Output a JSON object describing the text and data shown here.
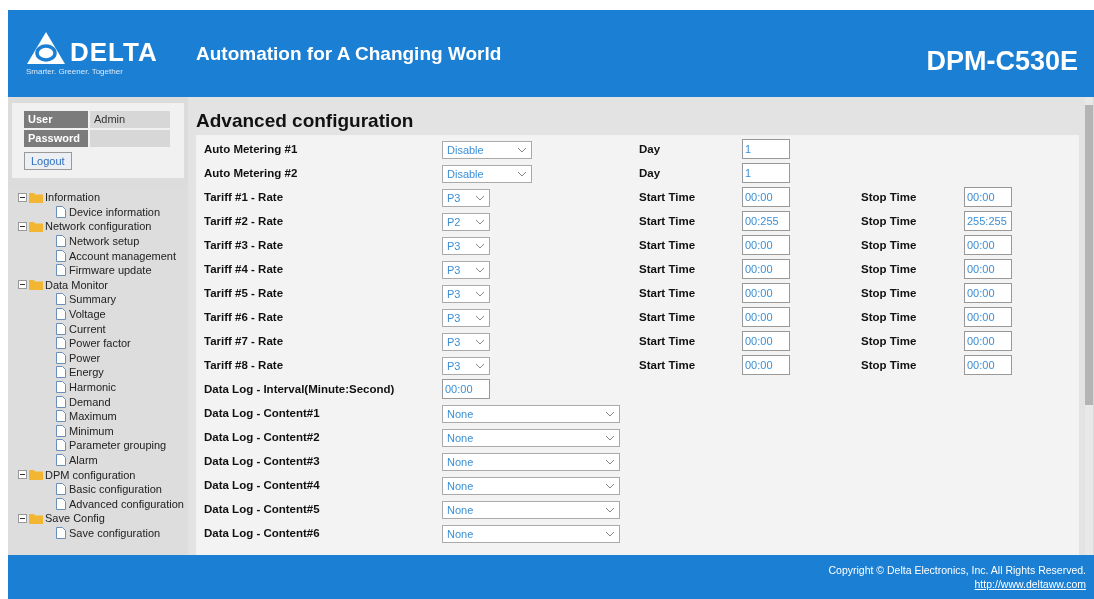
{
  "header": {
    "logo": {
      "name": "DELTA",
      "tagline": "Smarter. Greener. Together"
    },
    "slogan": "Automation for A Changing World",
    "model": "DPM-C530E"
  },
  "login": {
    "user_label": "User",
    "user_value": "Admin",
    "password_label": "Password",
    "logout": "Logout"
  },
  "tree": [
    {
      "label": "Information",
      "expanded": true,
      "children": [
        {
          "label": "Device information"
        }
      ]
    },
    {
      "label": "Network configuration",
      "expanded": true,
      "children": [
        {
          "label": "Network setup"
        },
        {
          "label": "Account management"
        },
        {
          "label": "Firmware update"
        }
      ]
    },
    {
      "label": "Data Monitor",
      "expanded": true,
      "children": [
        {
          "label": "Summary"
        },
        {
          "label": "Voltage"
        },
        {
          "label": "Current"
        },
        {
          "label": "Power factor"
        },
        {
          "label": "Power"
        },
        {
          "label": "Energy"
        },
        {
          "label": "Harmonic"
        },
        {
          "label": "Demand"
        },
        {
          "label": "Maximum"
        },
        {
          "label": "Minimum"
        },
        {
          "label": "Parameter grouping"
        },
        {
          "label": "Alarm"
        }
      ]
    },
    {
      "label": "DPM configuration",
      "expanded": true,
      "children": [
        {
          "label": "Basic configuration"
        },
        {
          "label": "Advanced configuration"
        }
      ]
    },
    {
      "label": "Save Config",
      "expanded": true,
      "children": [
        {
          "label": "Save configuration"
        }
      ]
    }
  ],
  "page_title": "Advanced configuration",
  "auto_metering": [
    {
      "label": "Auto Metering #1",
      "value": "Disable",
      "day_label": "Day",
      "day": "1"
    },
    {
      "label": "Auto Metering #2",
      "value": "Disable",
      "day_label": "Day",
      "day": "1"
    }
  ],
  "tariffs": [
    {
      "label": "Tariff #1 - Rate",
      "rate": "P3",
      "start_label": "Start Time",
      "start": "00:00",
      "stop_label": "Stop Time",
      "stop": "00:00"
    },
    {
      "label": "Tariff #2 - Rate",
      "rate": "P2",
      "start_label": "Start Time",
      "start": "00:255",
      "stop_label": "Stop Time",
      "stop": "255:255"
    },
    {
      "label": "Tariff #3 - Rate",
      "rate": "P3",
      "start_label": "Start Time",
      "start": "00:00",
      "stop_label": "Stop Time",
      "stop": "00:00"
    },
    {
      "label": "Tariff #4 - Rate",
      "rate": "P3",
      "start_label": "Start Time",
      "start": "00:00",
      "stop_label": "Stop Time",
      "stop": "00:00"
    },
    {
      "label": "Tariff #5 - Rate",
      "rate": "P3",
      "start_label": "Start Time",
      "start": "00:00",
      "stop_label": "Stop Time",
      "stop": "00:00"
    },
    {
      "label": "Tariff #6 - Rate",
      "rate": "P3",
      "start_label": "Start Time",
      "start": "00:00",
      "stop_label": "Stop Time",
      "stop": "00:00"
    },
    {
      "label": "Tariff #7 - Rate",
      "rate": "P3",
      "start_label": "Start Time",
      "start": "00:00",
      "stop_label": "Stop Time",
      "stop": "00:00"
    },
    {
      "label": "Tariff #8 - Rate",
      "rate": "P3",
      "start_label": "Start Time",
      "start": "00:00",
      "stop_label": "Stop Time",
      "stop": "00:00"
    }
  ],
  "interval": {
    "label": "Data Log - Interval(Minute:Second)",
    "value": "00:00"
  },
  "contents": [
    {
      "label": "Data Log - Content#1",
      "value": "None"
    },
    {
      "label": "Data Log - Content#2",
      "value": "None"
    },
    {
      "label": "Data Log - Content#3",
      "value": "None"
    },
    {
      "label": "Data Log - Content#4",
      "value": "None"
    },
    {
      "label": "Data Log - Content#5",
      "value": "None"
    },
    {
      "label": "Data Log - Content#6",
      "value": "None"
    }
  ],
  "footer": {
    "copyright": "Copyright © Delta Electronics, Inc. All Rights Reserved.",
    "link": "http://www.deltaww.com"
  }
}
